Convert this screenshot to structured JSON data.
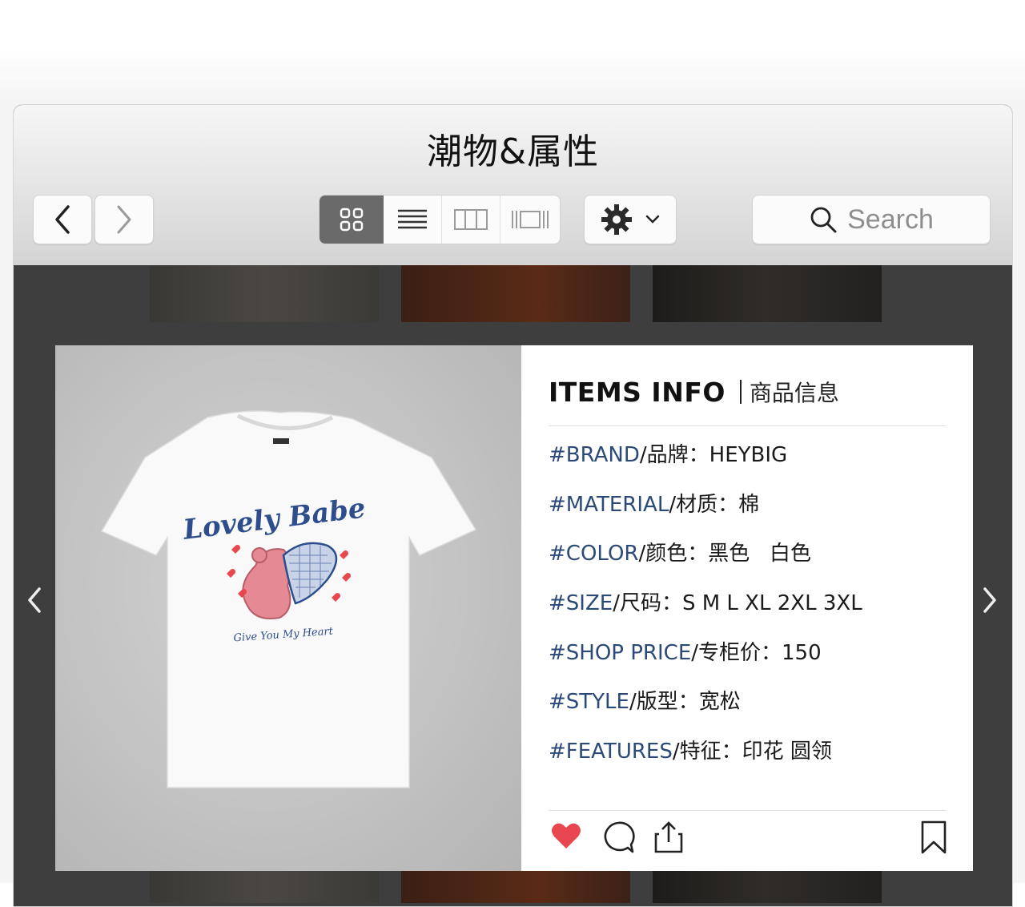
{
  "window": {
    "title": "潮物&属性"
  },
  "toolbar": {
    "view_modes": [
      "grid",
      "list",
      "columns",
      "gallery"
    ],
    "selected_view": "grid",
    "search": {
      "placeholder": "Search"
    }
  },
  "product": {
    "image_alt": "white t-shirt with bear holding heart print",
    "print_texts": [
      "Lovely Babe",
      "Give You My Heart"
    ],
    "info": {
      "title": "ITEMS INFO",
      "subtitle": "商品信息",
      "rows": [
        {
          "key": "#BRAND",
          "value": "/品牌：HEYBIG"
        },
        {
          "key": "#MATERIAL",
          "value": "/材质：棉"
        },
        {
          "key": "#COLOR",
          "value": "/颜色：黑色   白色"
        },
        {
          "key": "#SIZE",
          "value": "/尺码：S M L XL 2XL 3XL"
        },
        {
          "key": "#SHOP PRICE",
          "value": "/专柜价：150"
        },
        {
          "key": "#STYLE",
          "value": "/版型：宽松"
        },
        {
          "key": "#FEATURES",
          "value": "/特征：印花 圆领"
        }
      ]
    },
    "liked": true
  },
  "colors": {
    "accent_heart": "#e8474f",
    "key_blue": "#2c4a78",
    "selected_segment": "#6a6a6a",
    "print_blue": "#2e4d8c",
    "print_pink": "#e58a95"
  }
}
